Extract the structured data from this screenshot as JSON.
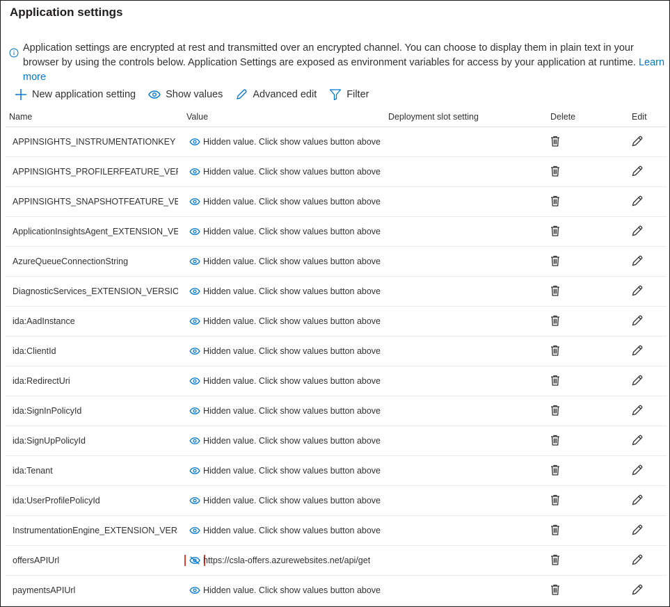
{
  "title": "Application settings",
  "info": {
    "text": "Application settings are encrypted at rest and transmitted over an encrypted channel. You can choose to display them in plain text in your browser by using the controls below. Application Settings are exposed as environment variables for access by your application at runtime.",
    "link": "Learn more"
  },
  "toolbar": {
    "new_setting": "New application setting",
    "show_values": "Show values",
    "advanced_edit": "Advanced edit",
    "filter": "Filter"
  },
  "columns": {
    "name": "Name",
    "value": "Value",
    "slot": "Deployment slot setting",
    "delete": "Delete",
    "edit": "Edit"
  },
  "rows": [
    {
      "name": "APPINSIGHTS_INSTRUMENTATIONKEY",
      "value": "Hidden value. Click show values button above to view"
    },
    {
      "name": "APPINSIGHTS_PROFILERFEATURE_VERSION",
      "value": "Hidden value. Click show values button above to view"
    },
    {
      "name": "APPINSIGHTS_SNAPSHOTFEATURE_VERSION",
      "value": "Hidden value. Click show values button above to view"
    },
    {
      "name": "ApplicationInsightsAgent_EXTENSION_VERSION",
      "value": "Hidden value. Click show values button above to view"
    },
    {
      "name": "AzureQueueConnectionString",
      "value": "Hidden value. Click show values button above to view"
    },
    {
      "name": "DiagnosticServices_EXTENSION_VERSION",
      "value": "Hidden value. Click show values button above to view"
    },
    {
      "name": "ida:AadInstance",
      "value": "Hidden value. Click show values button above to view"
    },
    {
      "name": "ida:ClientId",
      "value": "Hidden value. Click show values button above to view"
    },
    {
      "name": "ida:RedirectUri",
      "value": "Hidden value. Click show values button above to view"
    },
    {
      "name": "ida:SignInPolicyId",
      "value": "Hidden value. Click show values button above to view"
    },
    {
      "name": "ida:SignUpPolicyId",
      "value": "Hidden value. Click show values button above to view"
    },
    {
      "name": "ida:Tenant",
      "value": "Hidden value. Click show values button above to view"
    },
    {
      "name": "ida:UserProfilePolicyId",
      "value": "Hidden value. Click show values button above to view"
    },
    {
      "name": "InstrumentationEngine_EXTENSION_VERSION",
      "value": "Hidden value. Click show values button above to view"
    },
    {
      "name": "offersAPIUrl",
      "value": "https://csla-offers.azurewebsites.net/api/get",
      "revealed": true
    },
    {
      "name": "paymentsAPIUrl",
      "value": "Hidden value. Click show values button above to view"
    }
  ],
  "colors": {
    "accent": "#0078d4",
    "highlight": "#e0402f",
    "text": "#323130"
  },
  "icons": {
    "info": "info-icon",
    "add": "plus-icon",
    "show": "eye-icon",
    "hide": "eye-slash-icon",
    "edit": "pencil-icon",
    "filter": "funnel-icon",
    "delete": "trash-icon"
  }
}
